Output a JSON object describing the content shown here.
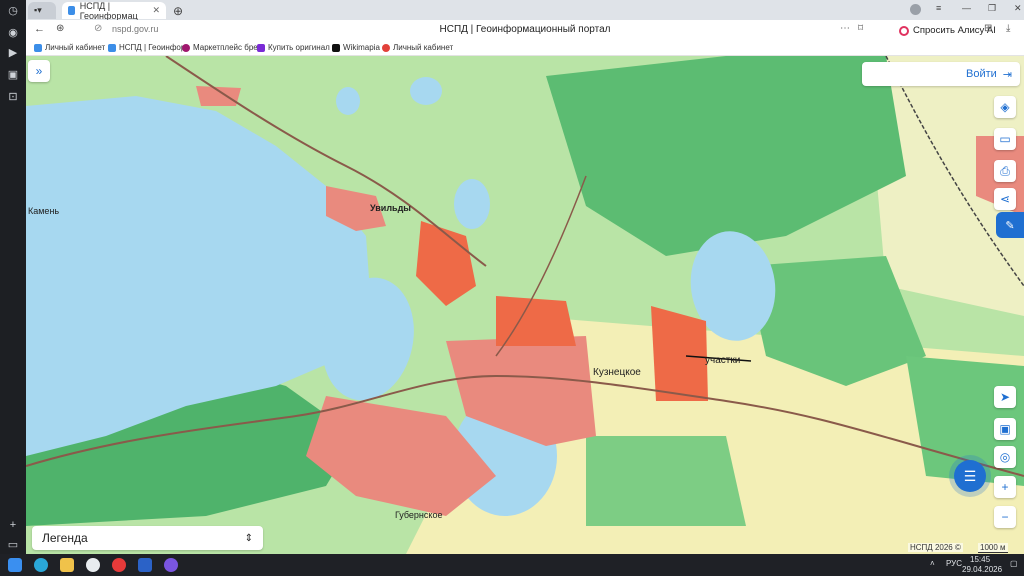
{
  "browser": {
    "tab_title": "НСПД | Геоинформац",
    "url": "nspd.gov.ru",
    "page_title": "НСПД | Геоинформационный портал",
    "alice_label": "Спросить Алису AI"
  },
  "bookmarks": [
    {
      "label": "Личный кабинет",
      "color": "#3c8ee8"
    },
    {
      "label": "НСПД | Геоинфор",
      "color": "#3c8ee8"
    },
    {
      "label": "Маркетплейс бре",
      "color": "#a0176e"
    },
    {
      "label": "Купить оригинал",
      "color": "#7a2bd6"
    },
    {
      "label": "Wikimapia",
      "color": "#111111"
    },
    {
      "label": "Личный кабинет",
      "color": "#e2413a"
    }
  ],
  "map": {
    "login_label": "Войти",
    "legend_label": "Легенда",
    "copyright": "НСПД 2026 ©",
    "scale_label": "1000 м",
    "place_labels": {
      "uvildy": "Увильды",
      "kamen": "Камень",
      "kuznetskoe": "Кузнецкое",
      "gubernskoe": "Губернское",
      "uchastki": "участки"
    }
  },
  "taskbar": {
    "language": "РУС",
    "time": "15:45",
    "date": "29.04.2026"
  }
}
